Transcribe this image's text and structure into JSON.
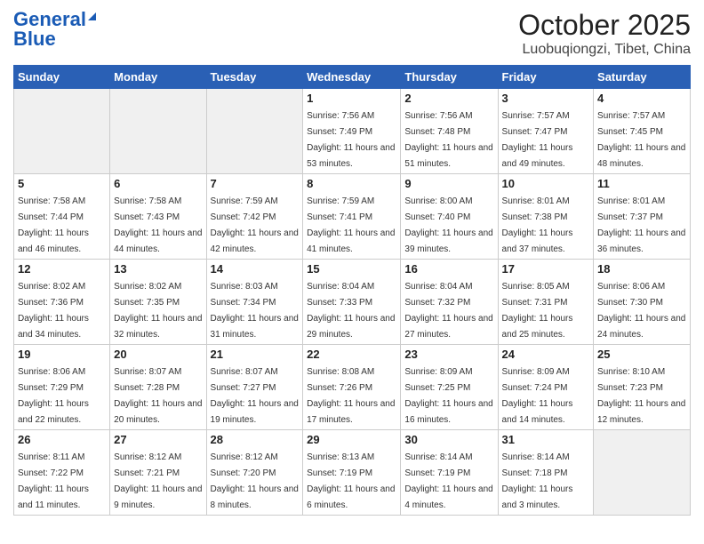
{
  "header": {
    "logo_line1": "General",
    "logo_line2": "Blue",
    "month": "October 2025",
    "location": "Luobuqiongzi, Tibet, China"
  },
  "weekdays": [
    "Sunday",
    "Monday",
    "Tuesday",
    "Wednesday",
    "Thursday",
    "Friday",
    "Saturday"
  ],
  "weeks": [
    [
      {
        "day": "",
        "empty": true
      },
      {
        "day": "",
        "empty": true
      },
      {
        "day": "",
        "empty": true
      },
      {
        "day": "1",
        "sunrise": "7:56 AM",
        "sunset": "7:49 PM",
        "daylight": "11 hours and 53 minutes."
      },
      {
        "day": "2",
        "sunrise": "7:56 AM",
        "sunset": "7:48 PM",
        "daylight": "11 hours and 51 minutes."
      },
      {
        "day": "3",
        "sunrise": "7:57 AM",
        "sunset": "7:47 PM",
        "daylight": "11 hours and 49 minutes."
      },
      {
        "day": "4",
        "sunrise": "7:57 AM",
        "sunset": "7:45 PM",
        "daylight": "11 hours and 48 minutes."
      }
    ],
    [
      {
        "day": "5",
        "sunrise": "7:58 AM",
        "sunset": "7:44 PM",
        "daylight": "11 hours and 46 minutes."
      },
      {
        "day": "6",
        "sunrise": "7:58 AM",
        "sunset": "7:43 PM",
        "daylight": "11 hours and 44 minutes."
      },
      {
        "day": "7",
        "sunrise": "7:59 AM",
        "sunset": "7:42 PM",
        "daylight": "11 hours and 42 minutes."
      },
      {
        "day": "8",
        "sunrise": "7:59 AM",
        "sunset": "7:41 PM",
        "daylight": "11 hours and 41 minutes."
      },
      {
        "day": "9",
        "sunrise": "8:00 AM",
        "sunset": "7:40 PM",
        "daylight": "11 hours and 39 minutes."
      },
      {
        "day": "10",
        "sunrise": "8:01 AM",
        "sunset": "7:38 PM",
        "daylight": "11 hours and 37 minutes."
      },
      {
        "day": "11",
        "sunrise": "8:01 AM",
        "sunset": "7:37 PM",
        "daylight": "11 hours and 36 minutes."
      }
    ],
    [
      {
        "day": "12",
        "sunrise": "8:02 AM",
        "sunset": "7:36 PM",
        "daylight": "11 hours and 34 minutes."
      },
      {
        "day": "13",
        "sunrise": "8:02 AM",
        "sunset": "7:35 PM",
        "daylight": "11 hours and 32 minutes."
      },
      {
        "day": "14",
        "sunrise": "8:03 AM",
        "sunset": "7:34 PM",
        "daylight": "11 hours and 31 minutes."
      },
      {
        "day": "15",
        "sunrise": "8:04 AM",
        "sunset": "7:33 PM",
        "daylight": "11 hours and 29 minutes."
      },
      {
        "day": "16",
        "sunrise": "8:04 AM",
        "sunset": "7:32 PM",
        "daylight": "11 hours and 27 minutes."
      },
      {
        "day": "17",
        "sunrise": "8:05 AM",
        "sunset": "7:31 PM",
        "daylight": "11 hours and 25 minutes."
      },
      {
        "day": "18",
        "sunrise": "8:06 AM",
        "sunset": "7:30 PM",
        "daylight": "11 hours and 24 minutes."
      }
    ],
    [
      {
        "day": "19",
        "sunrise": "8:06 AM",
        "sunset": "7:29 PM",
        "daylight": "11 hours and 22 minutes."
      },
      {
        "day": "20",
        "sunrise": "8:07 AM",
        "sunset": "7:28 PM",
        "daylight": "11 hours and 20 minutes."
      },
      {
        "day": "21",
        "sunrise": "8:07 AM",
        "sunset": "7:27 PM",
        "daylight": "11 hours and 19 minutes."
      },
      {
        "day": "22",
        "sunrise": "8:08 AM",
        "sunset": "7:26 PM",
        "daylight": "11 hours and 17 minutes."
      },
      {
        "day": "23",
        "sunrise": "8:09 AM",
        "sunset": "7:25 PM",
        "daylight": "11 hours and 16 minutes."
      },
      {
        "day": "24",
        "sunrise": "8:09 AM",
        "sunset": "7:24 PM",
        "daylight": "11 hours and 14 minutes."
      },
      {
        "day": "25",
        "sunrise": "8:10 AM",
        "sunset": "7:23 PM",
        "daylight": "11 hours and 12 minutes."
      }
    ],
    [
      {
        "day": "26",
        "sunrise": "8:11 AM",
        "sunset": "7:22 PM",
        "daylight": "11 hours and 11 minutes."
      },
      {
        "day": "27",
        "sunrise": "8:12 AM",
        "sunset": "7:21 PM",
        "daylight": "11 hours and 9 minutes."
      },
      {
        "day": "28",
        "sunrise": "8:12 AM",
        "sunset": "7:20 PM",
        "daylight": "11 hours and 8 minutes."
      },
      {
        "day": "29",
        "sunrise": "8:13 AM",
        "sunset": "7:19 PM",
        "daylight": "11 hours and 6 minutes."
      },
      {
        "day": "30",
        "sunrise": "8:14 AM",
        "sunset": "7:19 PM",
        "daylight": "11 hours and 4 minutes."
      },
      {
        "day": "31",
        "sunrise": "8:14 AM",
        "sunset": "7:18 PM",
        "daylight": "11 hours and 3 minutes."
      },
      {
        "day": "",
        "empty": true
      }
    ]
  ]
}
